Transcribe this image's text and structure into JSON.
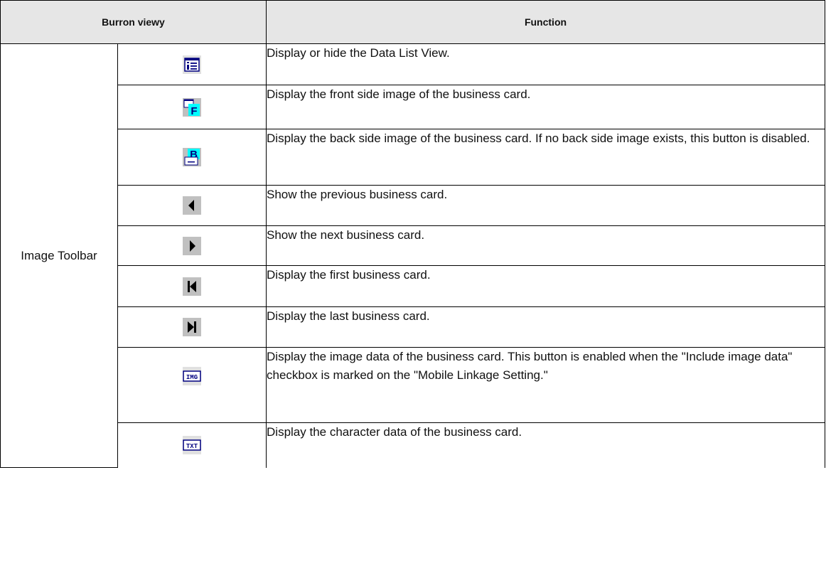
{
  "header": {
    "button_view": "Burron viewy",
    "function": "Function"
  },
  "group_label": "Image Toolbar",
  "rows": [
    {
      "icon": "data-list-view-icon",
      "function": "Display or hide the Data List View."
    },
    {
      "icon": "front-side-icon",
      "function": "Display the front side image of the business card."
    },
    {
      "icon": "back-side-icon",
      "function": "Display the back side image of the business card. If no back side image exists, this button is disabled."
    },
    {
      "icon": "previous-icon",
      "function": "Show the previous business card."
    },
    {
      "icon": "next-icon",
      "function": "Show the next business card."
    },
    {
      "icon": "first-icon",
      "function": "Display the first business card."
    },
    {
      "icon": "last-icon",
      "function": "Display the last business card."
    },
    {
      "icon": "image-data-icon",
      "icon_text": "IMG",
      "function": "Display the image data of the business card. This button is enabled when the \"Include image data\" checkbox is marked on the \"Mobile Linkage Setting.\""
    },
    {
      "icon": "text-data-icon",
      "icon_text": "TXT",
      "function": "Display the character data of the business card."
    }
  ],
  "colors": {
    "header_bg": "#e6e6e6",
    "icon_cyan": "#00ffff",
    "icon_gray": "#c0c0c0",
    "icon_navy": "#000080"
  }
}
